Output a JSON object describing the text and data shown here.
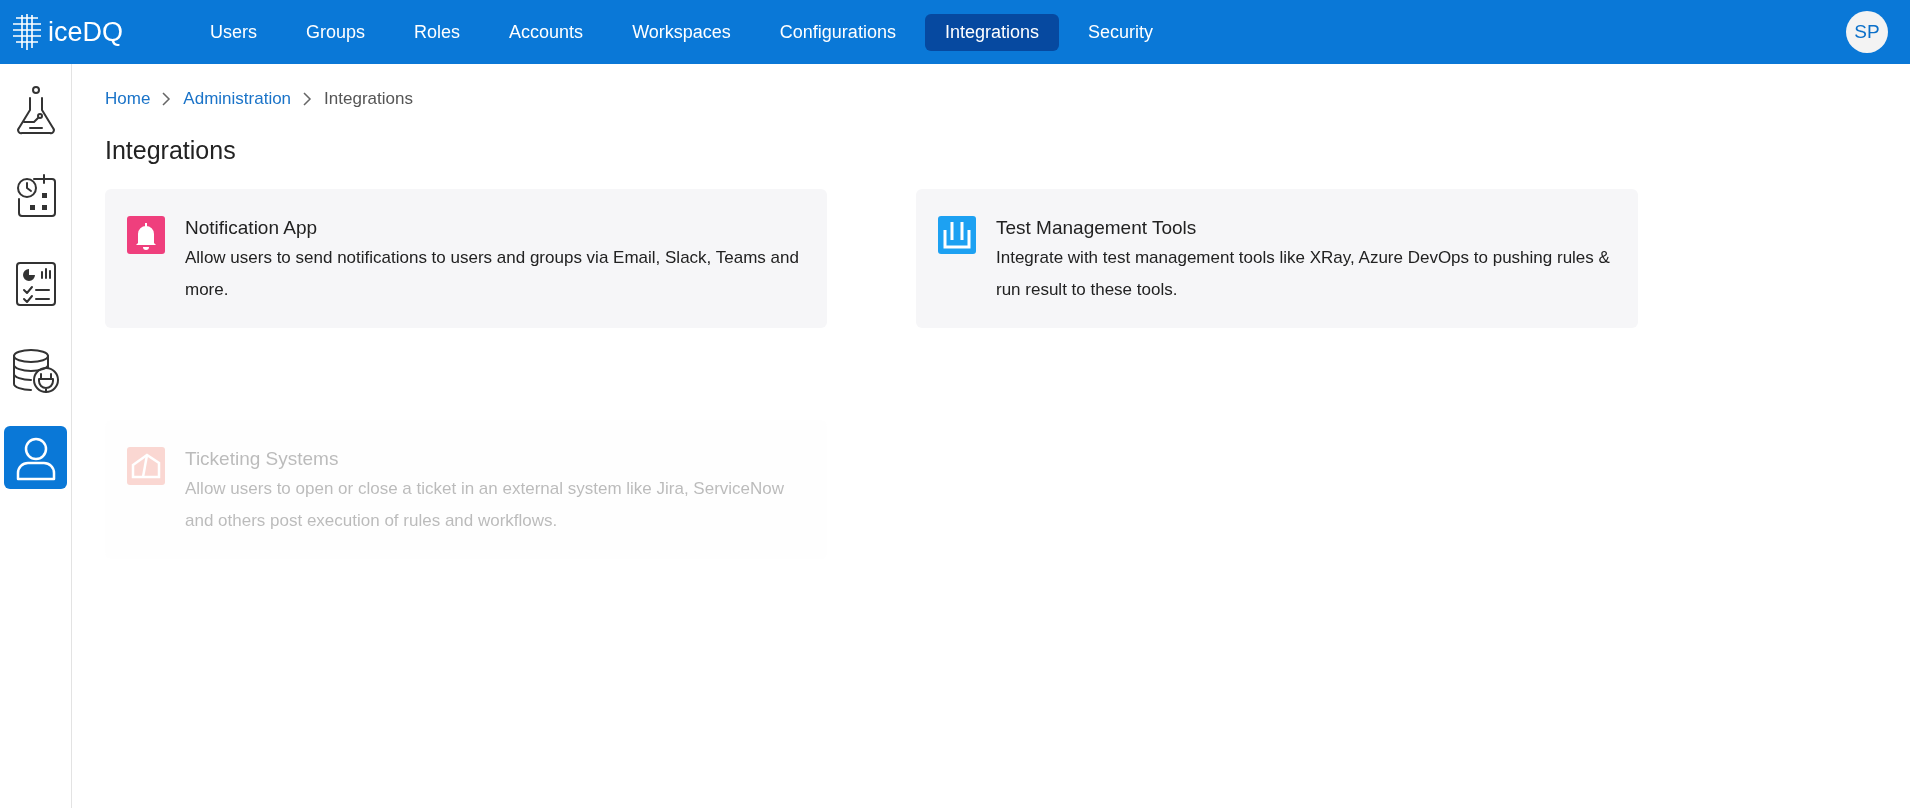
{
  "logo": {
    "text": "iceDQ"
  },
  "nav": [
    {
      "label": "Users",
      "selected": false
    },
    {
      "label": "Groups",
      "selected": false
    },
    {
      "label": "Roles",
      "selected": false
    },
    {
      "label": "Accounts",
      "selected": false
    },
    {
      "label": "Workspaces",
      "selected": false
    },
    {
      "label": "Configurations",
      "selected": false
    },
    {
      "label": "Integrations",
      "selected": true
    },
    {
      "label": "Security",
      "selected": false
    }
  ],
  "avatar": "SP",
  "sidebar": [
    {
      "kind": "flask",
      "selected": false
    },
    {
      "kind": "schedule",
      "selected": false
    },
    {
      "kind": "report",
      "selected": false
    },
    {
      "kind": "database",
      "selected": false
    },
    {
      "kind": "user",
      "selected": true
    }
  ],
  "breadcrumb": [
    "Home",
    "Administration",
    "Integrations"
  ],
  "title": "Integrations",
  "cards": [
    {
      "kind": "bell",
      "title": "Notification App",
      "description": "Allow users to send notifications to users and groups via Email, Slack, Teams and more.",
      "disabled": false
    },
    {
      "kind": "tubes",
      "title": "Test Management Tools",
      "description": "Integrate with test management tools like XRay, Azure DevOps to pushing rules & run result to these tools.",
      "disabled": false
    },
    {
      "kind": "ticket",
      "title": "Ticketing Systems",
      "description": "Allow users to open or close a ticket in an external system like Jira, ServiceNow and others post execution of rules and workflows.",
      "disabled": true
    }
  ]
}
